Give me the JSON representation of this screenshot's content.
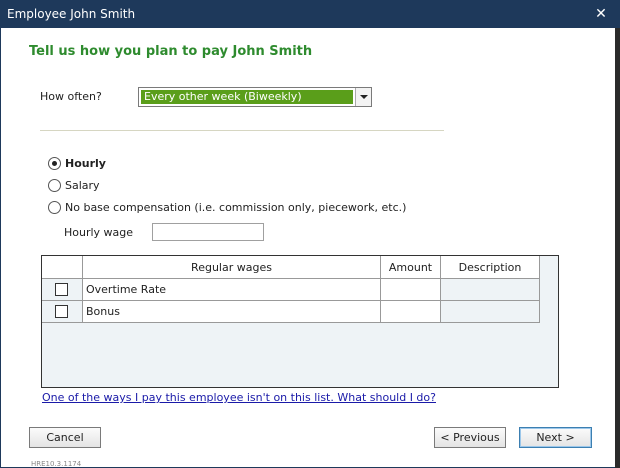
{
  "window": {
    "title": "Employee John Smith",
    "close_glyph": "✕"
  },
  "heading": "Tell us how you plan to pay John Smith",
  "pay_frequency": {
    "label": "How often?",
    "selected": "Every other week (Biweekly)"
  },
  "pay_type": {
    "options": [
      {
        "label": "Hourly",
        "checked": true
      },
      {
        "label": "Salary",
        "checked": false
      },
      {
        "label": "No base compensation (i.e. commission only, piecework, etc.)",
        "checked": false
      }
    ]
  },
  "hourly_wage": {
    "label": "Hourly wage",
    "value": ""
  },
  "wages_table": {
    "columns": [
      "Regular wages",
      "Amount",
      "Description"
    ],
    "rows": [
      {
        "label": "Overtime Rate",
        "amount": "",
        "description": ""
      },
      {
        "label": "Bonus",
        "amount": "",
        "description": ""
      }
    ]
  },
  "help_link": "One of the ways I pay this employee isn't on this list.  What should I do?",
  "buttons": {
    "cancel": "Cancel",
    "previous": "< Previous",
    "next": "Next >"
  },
  "footer": {
    "code": "HRE10.3.1174"
  }
}
